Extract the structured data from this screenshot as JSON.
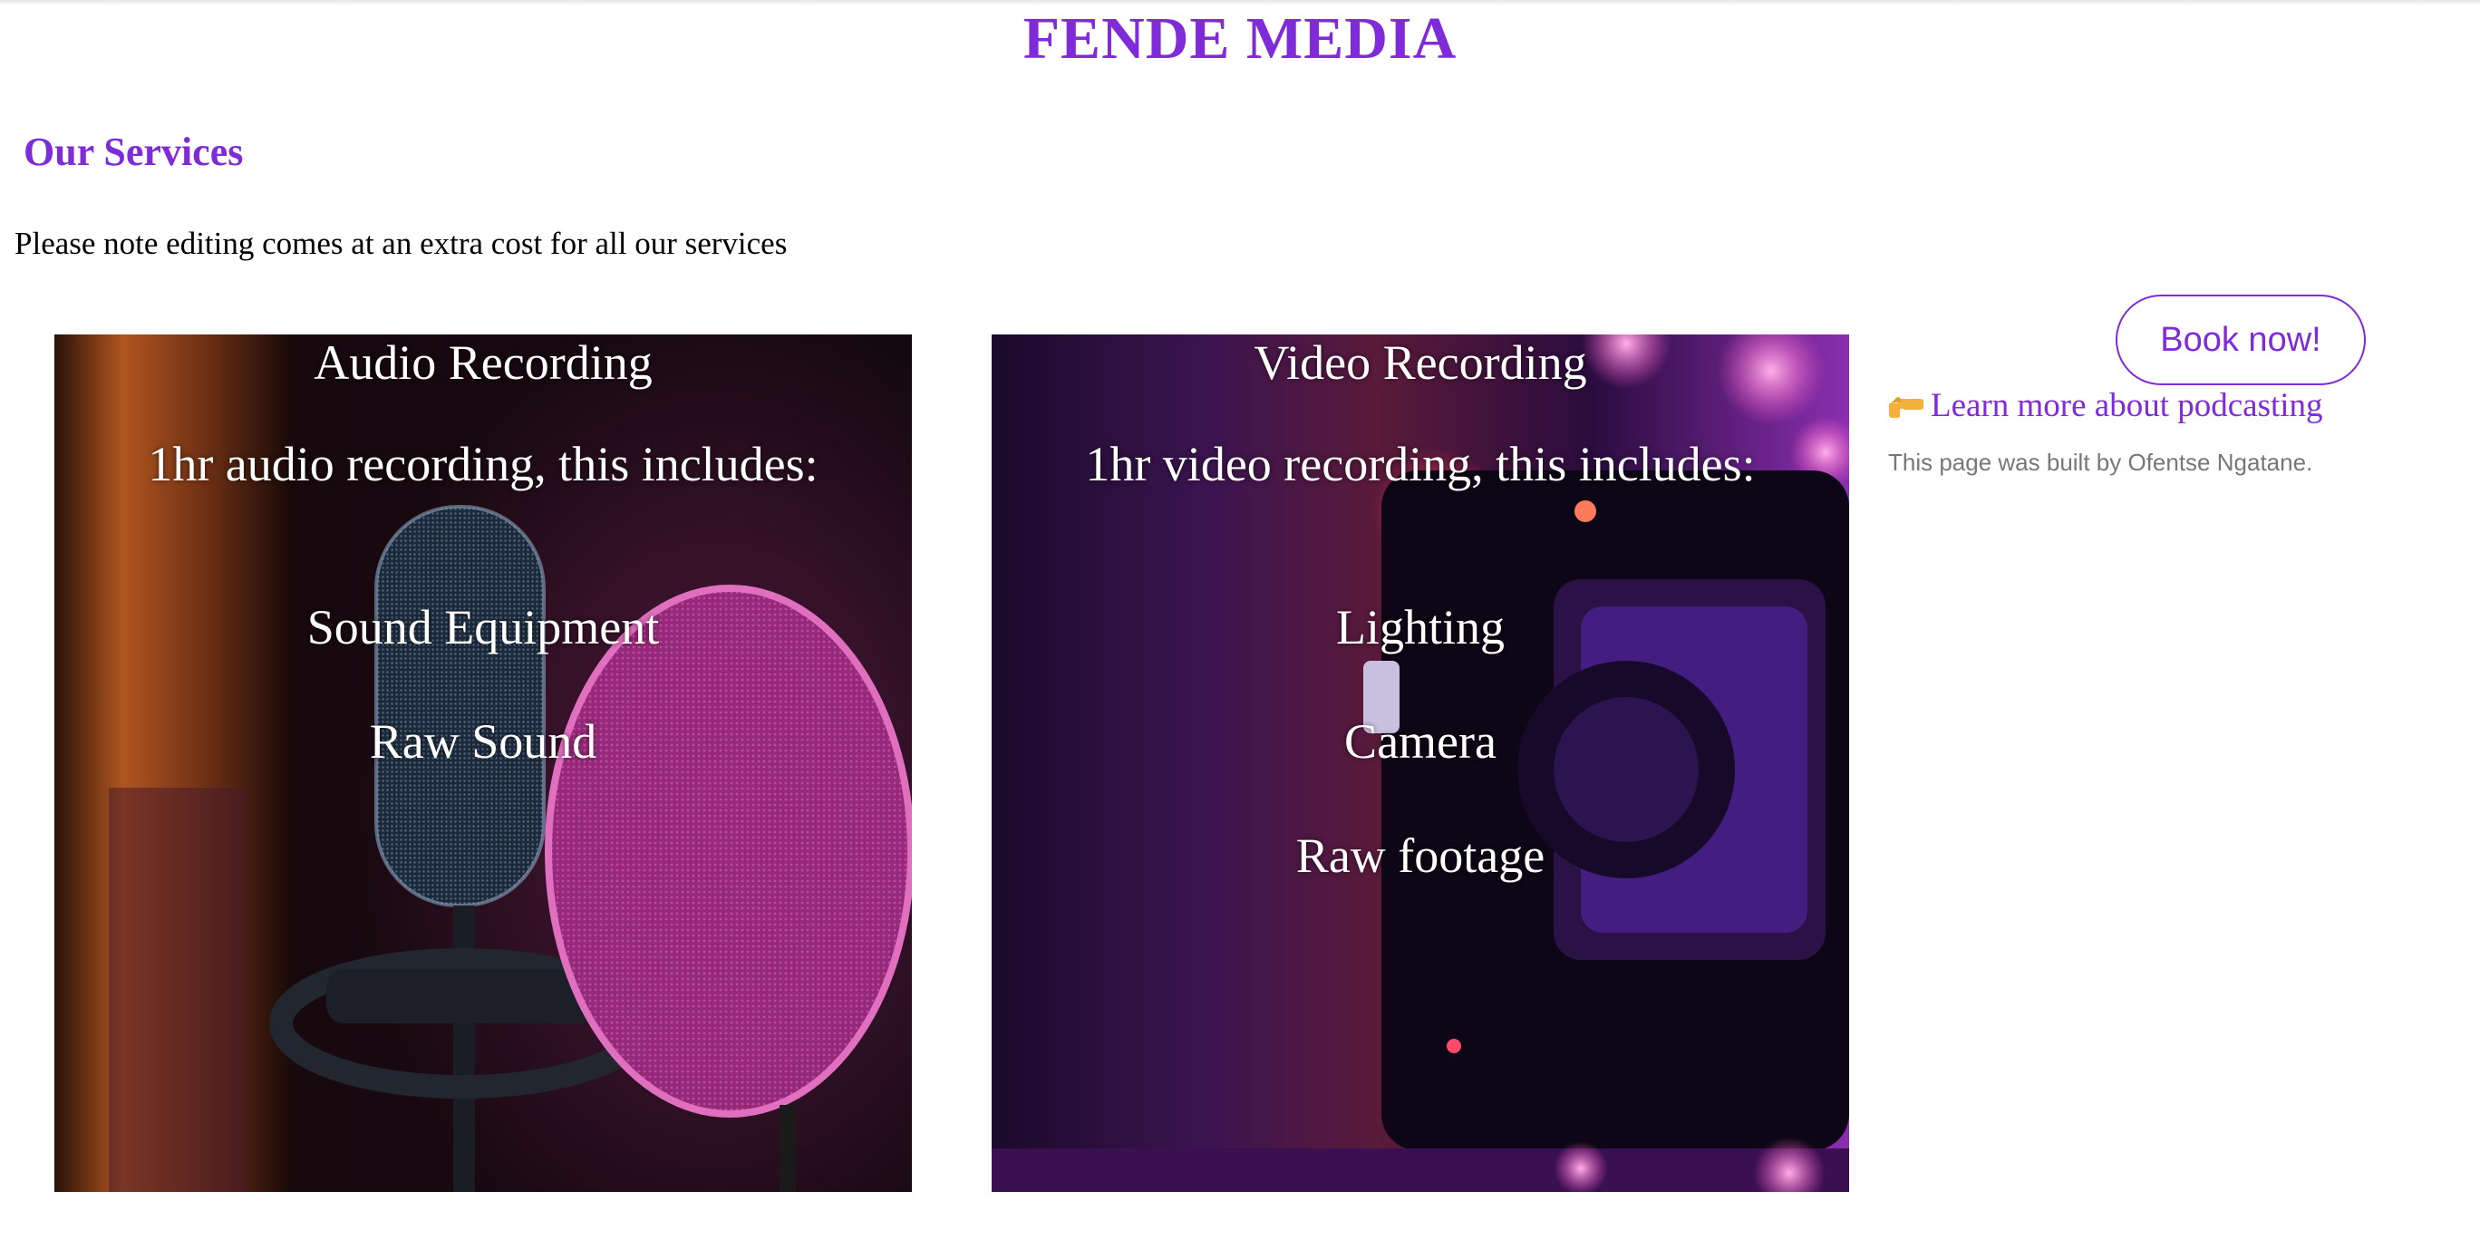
{
  "header": {
    "title": "FENDE MEDIA"
  },
  "services": {
    "heading": "Our Services",
    "note": "Please note editing comes at an extra cost for all our services"
  },
  "cards": [
    {
      "title": "Audio Recording",
      "subtitle": "1hr audio recording, this includes:",
      "items": [
        "Sound Equipment",
        "Raw Sound"
      ]
    },
    {
      "title": "Video Recording",
      "subtitle": "1hr video recording, this includes:",
      "items": [
        "Lighting",
        "Camera",
        "Raw footage"
      ]
    }
  ],
  "sidebar": {
    "book_button": "Book now!",
    "learn_link": "Learn more about podcasting",
    "learn_icon": "pointing-hand-icon",
    "credit": "This page was built by Ofentse Ngatane."
  },
  "colors": {
    "accent": "#7f2bd9",
    "muted": "#777777"
  }
}
